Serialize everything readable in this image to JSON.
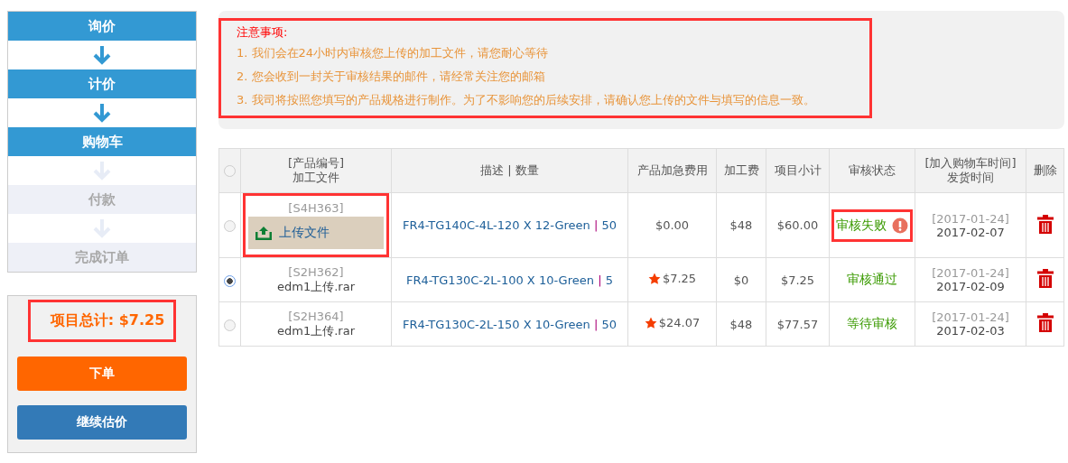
{
  "steps": [
    {
      "label": "询价",
      "done": true
    },
    {
      "label": "计价",
      "done": true
    },
    {
      "label": "购物车",
      "done": true
    },
    {
      "label": "付款",
      "done": false
    },
    {
      "label": "完成订单",
      "done": false
    }
  ],
  "summary": {
    "total": "项目总计: $7.25",
    "highlighted": true,
    "buttons": [
      {
        "label": "下单",
        "kind": "primary"
      },
      {
        "label": "继续估价",
        "kind": "secondary"
      }
    ]
  },
  "notice": {
    "title": "注意事项:",
    "highlighted": true,
    "items": [
      "1. 我们会在24小时内审核您上传的加工文件，请您耐心等待",
      "2. 您会收到一封关于审核结果的邮件，请经常关注您的邮箱",
      "3. 我司将按照您填写的产品规格进行制作。为了不影响您的后续安排，请确认您上传的文件与填写的信息一致。"
    ]
  },
  "table": {
    "header_select": {
      "selected": false
    },
    "columns": [
      [
        "[产品编号]",
        "加工文件"
      ],
      [
        "描述 | 数量"
      ],
      [
        "产品加急费用"
      ],
      [
        "加工费"
      ],
      [
        "项目小计"
      ],
      [
        "审核状态"
      ],
      [
        "[加入购物车时间]",
        "发货时间"
      ],
      [
        "删除"
      ]
    ],
    "rows": [
      {
        "selected": false,
        "code": "[S4H363]",
        "file": {
          "kind": "upload",
          "label": "上传文件"
        },
        "file_highlighted": true,
        "description": "FR4-TG140C-4L-120 X 12-Green",
        "separator": "|",
        "quantity": "50",
        "urgent": false,
        "rush_fee": "$0.00",
        "fee": "$48",
        "subtotal": "$60.00",
        "status": {
          "kind": "failed",
          "label": "审核失败"
        },
        "status_highlighted": true,
        "added": "[2017-01-24]",
        "ship": "2017-02-07"
      },
      {
        "selected": true,
        "code": "[S2H362]",
        "file": {
          "kind": "name",
          "label": "edm1上传.rar"
        },
        "file_highlighted": false,
        "description": "FR4-TG130C-2L-100 X 10-Green",
        "separator": "|",
        "quantity": "5",
        "urgent": true,
        "rush_fee": "$7.25",
        "fee": "$0",
        "subtotal": "$7.25",
        "status": {
          "kind": "passed",
          "label": "审核通过"
        },
        "status_highlighted": false,
        "added": "[2017-01-24]",
        "ship": "2017-02-09"
      },
      {
        "selected": false,
        "code": "[S2H364]",
        "file": {
          "kind": "name",
          "label": "edm1上传.rar"
        },
        "file_highlighted": false,
        "description": "FR4-TG130C-2L-150 X 10-Green",
        "separator": "|",
        "quantity": "50",
        "urgent": true,
        "rush_fee": "$24.07",
        "fee": "$48",
        "subtotal": "$77.57",
        "status": {
          "kind": "pending",
          "label": "等待审核"
        },
        "status_highlighted": false,
        "added": "[2017-01-24]",
        "ship": "2017-02-03"
      }
    ]
  }
}
